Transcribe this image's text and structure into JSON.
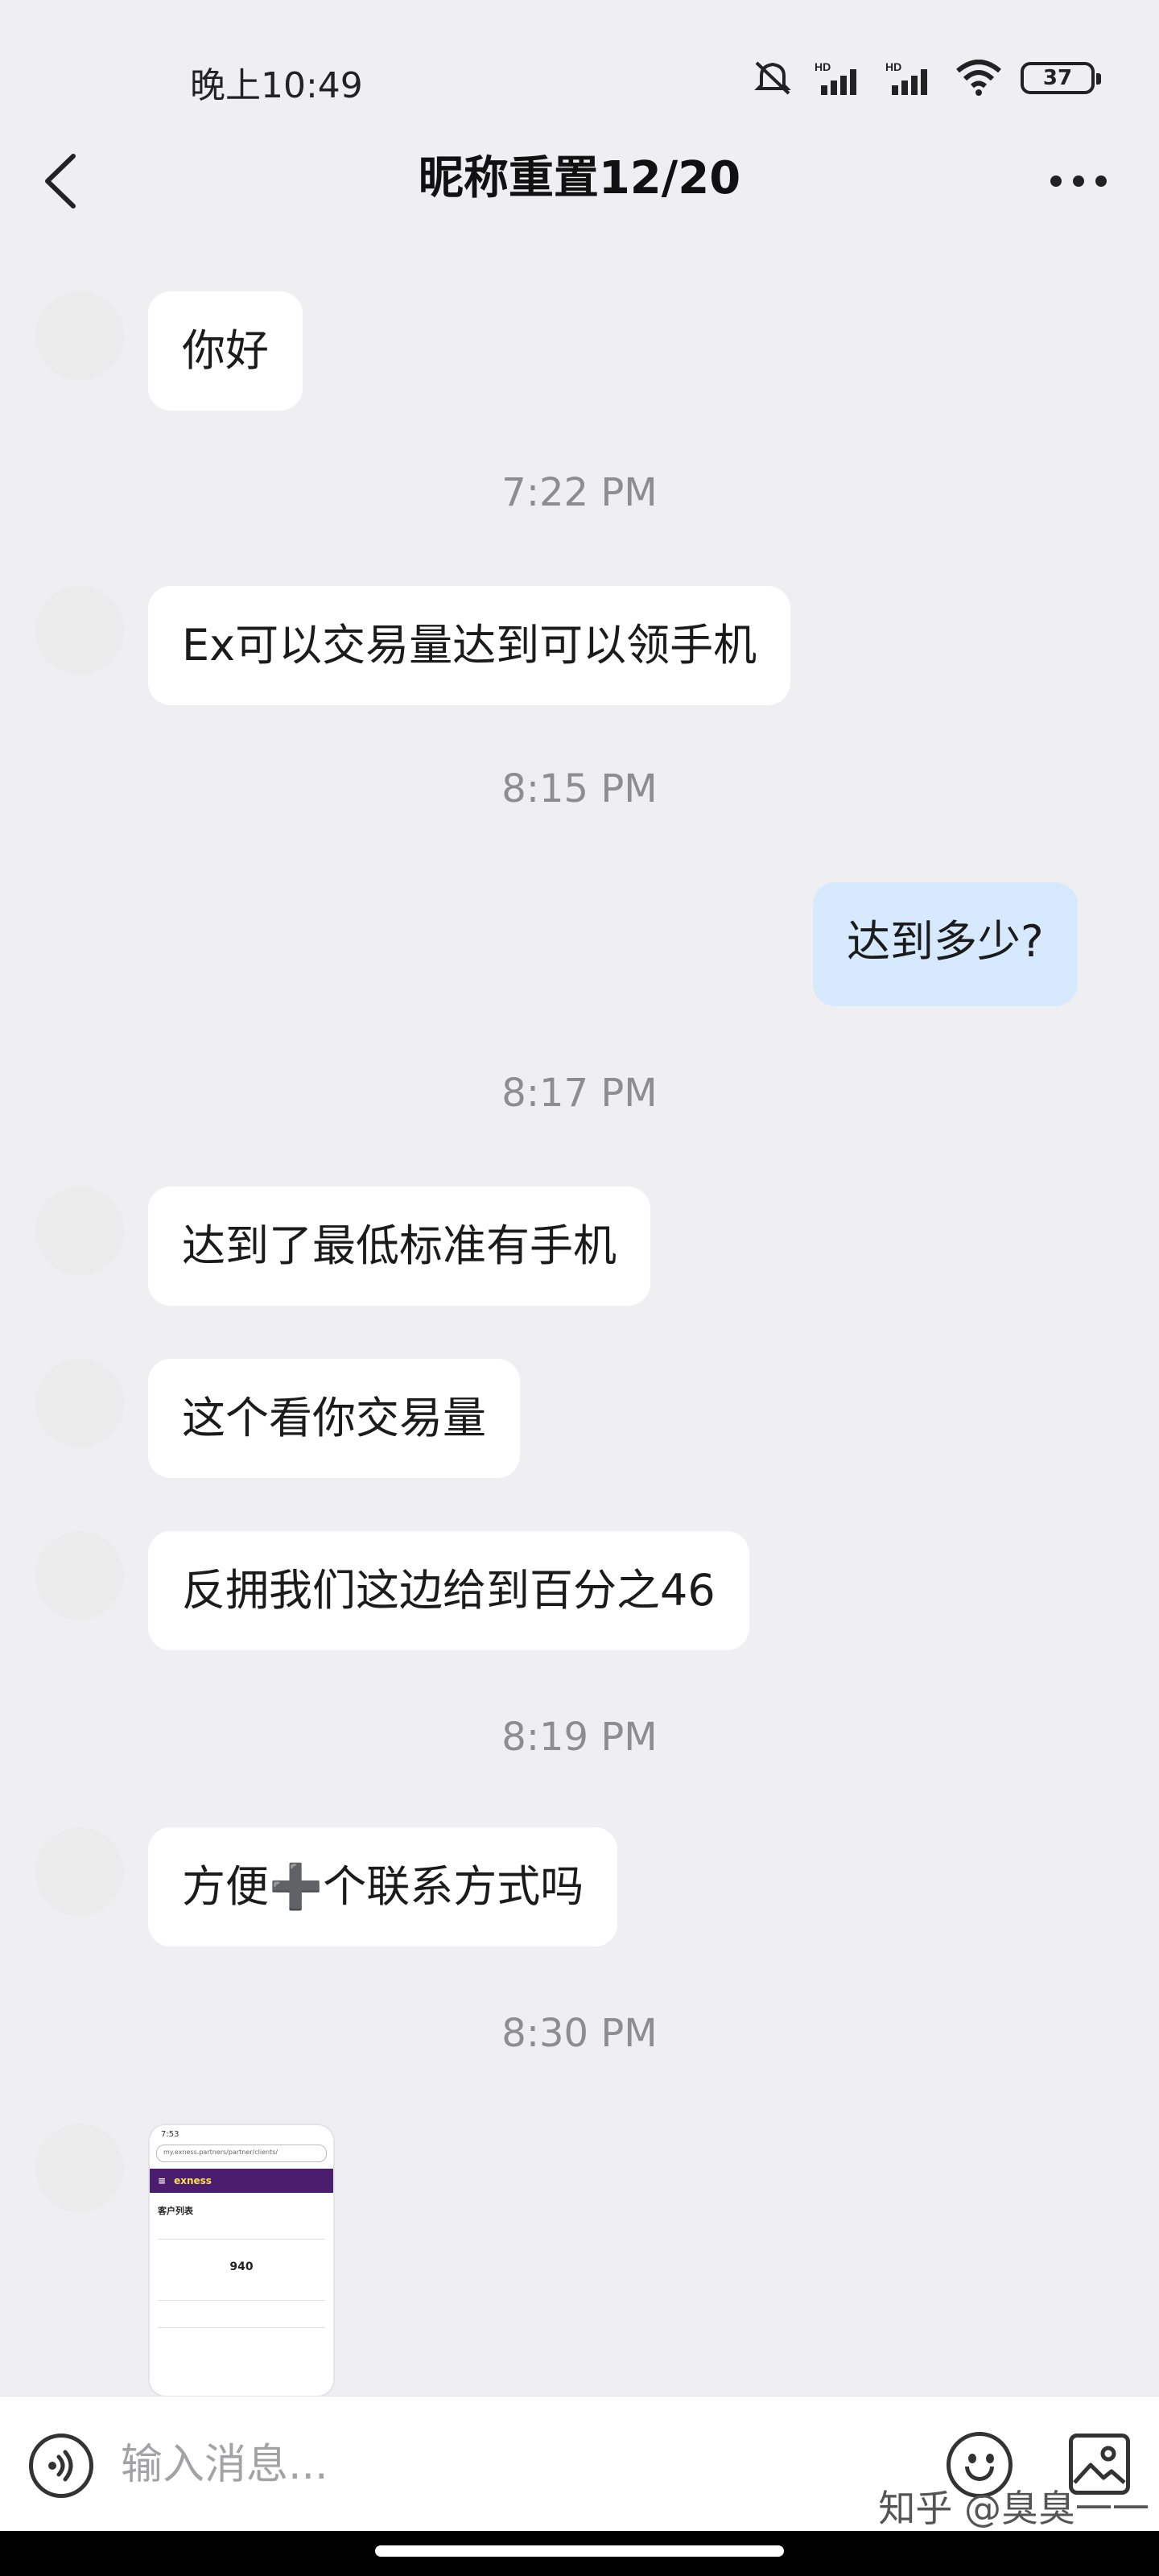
{
  "status_bar": {
    "time": "晚上10:49",
    "battery": "37",
    "icons": [
      "mute-icon",
      "hd-signal-icon",
      "hd-signal-icon",
      "wifi-icon",
      "battery-icon"
    ]
  },
  "header": {
    "title": "昵称重置12/20",
    "back_icon": "chevron-left-icon",
    "more_icon": "more-dots-icon"
  },
  "messages": [
    {
      "side": "left",
      "text": "你好"
    },
    {
      "type": "time",
      "text": "7:22 PM"
    },
    {
      "side": "left",
      "text": "Ex可以交易量达到可以领手机"
    },
    {
      "type": "time",
      "text": "8:15 PM"
    },
    {
      "side": "right",
      "text": "达到多少?"
    },
    {
      "type": "time",
      "text": "8:17 PM"
    },
    {
      "side": "left",
      "text": "达到了最低标准有手机"
    },
    {
      "side": "left",
      "text": "这个看你交易量"
    },
    {
      "side": "left",
      "text": "反拥我们这边给到百分之46"
    },
    {
      "type": "time",
      "text": "8:19 PM"
    },
    {
      "side": "left",
      "text": "方便➕个联系方式吗"
    },
    {
      "type": "time",
      "text": "8:30 PM"
    },
    {
      "side": "left",
      "type": "image"
    }
  ],
  "image_thumb": {
    "status_time": "7:53",
    "url": "my.exness.partners/partner/clients/",
    "brand": "exness",
    "page_title": "客户列表",
    "number": "940"
  },
  "input_bar": {
    "placeholder": "输入消息...",
    "voice_icon": "voice-icon",
    "emoji_icon": "emoji-icon",
    "gallery_icon": "gallery-icon"
  },
  "watermark": "知乎 @臭臭一一"
}
